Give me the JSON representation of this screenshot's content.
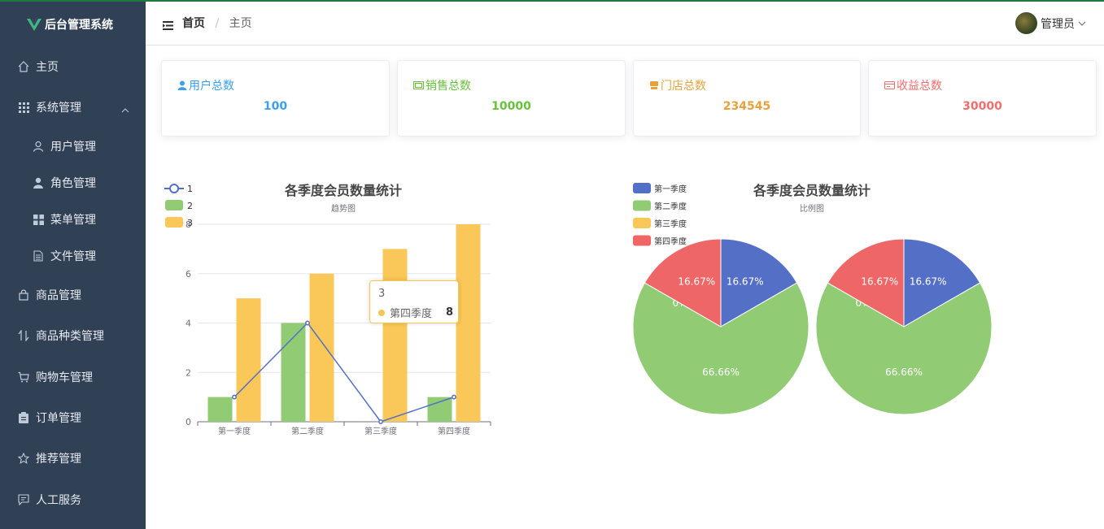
{
  "app": {
    "title": "后台管理系统"
  },
  "sidebar": {
    "items": [
      {
        "label": "主页",
        "icon": "home-icon"
      },
      {
        "label": "系统管理",
        "icon": "grid-icon",
        "expanded": true
      },
      {
        "label": "用户管理",
        "icon": "user-icon",
        "sub": true
      },
      {
        "label": "角色管理",
        "icon": "user-solid-icon",
        "sub": true
      },
      {
        "label": "菜单管理",
        "icon": "menu-icon",
        "sub": true
      },
      {
        "label": "文件管理",
        "icon": "document-icon",
        "sub": true
      },
      {
        "label": "商品管理",
        "icon": "bag-icon"
      },
      {
        "label": "商品种类管理",
        "icon": "sort-icon"
      },
      {
        "label": "购物车管理",
        "icon": "cart-icon"
      },
      {
        "label": "订单管理",
        "icon": "order-icon"
      },
      {
        "label": "推荐管理",
        "icon": "star-icon"
      },
      {
        "label": "人工服务",
        "icon": "chat-icon"
      }
    ]
  },
  "header": {
    "breadcrumb": [
      "首页",
      "主页"
    ],
    "user": "管理员"
  },
  "cards": [
    {
      "title": "用户总数",
      "value": "100",
      "color": "#3a9ff0"
    },
    {
      "title": "销售总数",
      "value": "10000",
      "color": "#67c23a"
    },
    {
      "title": "门店总数",
      "value": "234545",
      "color": "#e6a23c"
    },
    {
      "title": "收益总数",
      "value": "30000",
      "color": "#f56c6c"
    }
  ],
  "colors": {
    "blue": "#5470c6",
    "green": "#91cc75",
    "yellow": "#fac858",
    "red": "#ee6666",
    "sidebar": "#304156"
  },
  "chart_data": [
    {
      "type": "bar",
      "title": "各季度会员数量统计",
      "subtitle": "趋势图",
      "categories": [
        "第一季度",
        "第二季度",
        "第三季度",
        "第四季度"
      ],
      "ylim": [
        0,
        8
      ],
      "yticks": [
        0,
        2,
        4,
        6,
        8
      ],
      "legend": [
        "1",
        "2",
        "3"
      ],
      "series": [
        {
          "name": "1",
          "kind": "line",
          "values": [
            1,
            4,
            0,
            1
          ],
          "color": "#5470c6"
        },
        {
          "name": "2",
          "kind": "bar",
          "values": [
            1,
            4,
            0,
            1
          ],
          "color": "#91cc75"
        },
        {
          "name": "3",
          "kind": "bar",
          "values": [
            5,
            6,
            7,
            8
          ],
          "color": "#fac858"
        }
      ],
      "tooltip": {
        "title": "3",
        "label": "第四季度",
        "value": "8"
      }
    },
    {
      "type": "pie",
      "title": "各季度会员数量统计",
      "subtitle": "比例图",
      "legend": [
        "第一季度",
        "第二季度",
        "第三季度",
        "第四季度"
      ],
      "pies": [
        {
          "slices": [
            {
              "name": "第一季度",
              "value": 16.67,
              "label": "16.67%",
              "color": "#5470c6"
            },
            {
              "name": "第二季度",
              "value": 66.66,
              "label": "66.66%",
              "color": "#91cc75"
            },
            {
              "name": "第三季度",
              "value": 0,
              "label": "0%",
              "color": "#fac858"
            },
            {
              "name": "第四季度",
              "value": 16.67,
              "label": "16.67%",
              "color": "#ee6666"
            }
          ]
        },
        {
          "slices": [
            {
              "name": "第一季度",
              "value": 16.67,
              "label": "16.67%",
              "color": "#5470c6"
            },
            {
              "name": "第二季度",
              "value": 66.66,
              "label": "66.66%",
              "color": "#91cc75"
            },
            {
              "name": "第三季度",
              "value": 0,
              "label": "0%",
              "color": "#fac858"
            },
            {
              "name": "第四季度",
              "value": 16.67,
              "label": "16.67%",
              "color": "#ee6666"
            }
          ]
        }
      ]
    }
  ]
}
